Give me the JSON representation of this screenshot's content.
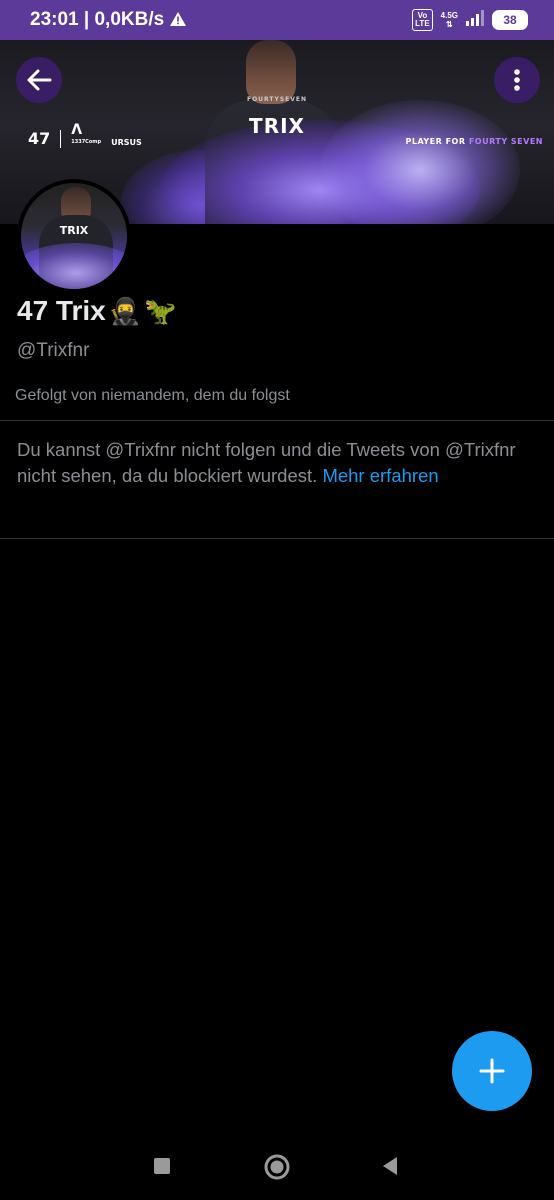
{
  "status_bar": {
    "time": "23:01",
    "speed": "| 0,0KB/s",
    "volte_label": "Vo\nLTE",
    "network": "4.5G",
    "battery": "38"
  },
  "banner": {
    "jersey_small": "FOURTYSEVEN",
    "jersey_name": "TRIX",
    "logo_47": "47",
    "logo_a": "Λ",
    "logo_a_sub": "1337Comp",
    "logo_ursus": "URSUS",
    "player_for_prefix": "PLAYER FOR",
    "player_for_team": "FOURTY SEVEN"
  },
  "avatar": {
    "text": "TRIX"
  },
  "profile": {
    "display_name": "47 Trix",
    "emoji_ninja": "🥷",
    "emoji_dino": "🦖",
    "handle": "@Trixfnr",
    "followed_by": "Gefolgt von niemandem, dem du folgst"
  },
  "blocked": {
    "message": "Du kannst @Trixfnr nicht folgen und die Tweets von @Trixfnr nicht sehen, da du blockiert wurdest.",
    "link_label": "Mehr erfahren"
  },
  "colors": {
    "status_bar": "#5b3a9a",
    "accent": "#1d9bf0",
    "background": "#000000",
    "secondary_text": "#8b8f94"
  },
  "icons": {
    "back": "arrow-left-icon",
    "more": "more-vertical-icon",
    "compose": "plus-icon",
    "nav_recents": "square-icon",
    "nav_home": "circle-icon",
    "nav_back": "triangle-back-icon"
  }
}
